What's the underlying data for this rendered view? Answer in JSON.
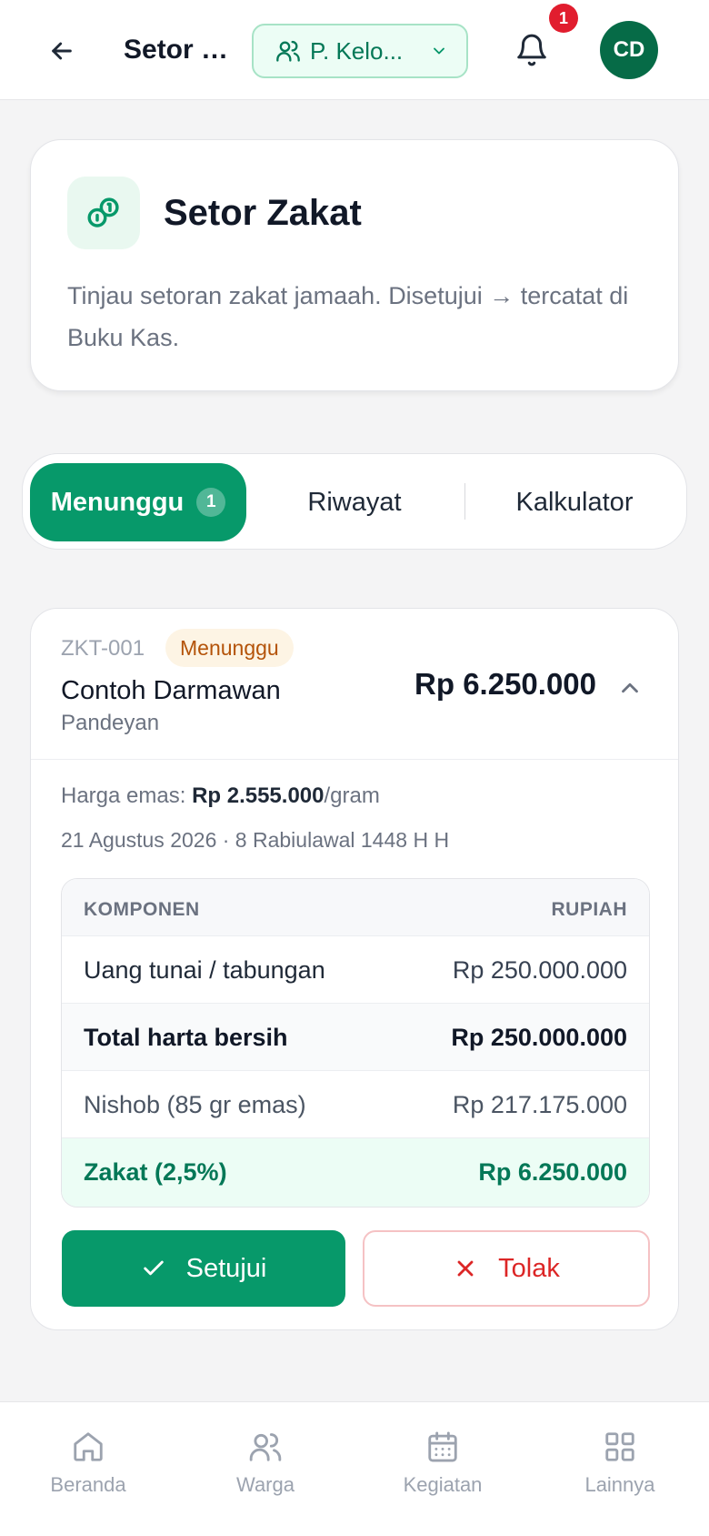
{
  "header": {
    "title": "Setor Z...",
    "org_select": "P. Kelo...",
    "notification_count": "1",
    "avatar_initials": "CD"
  },
  "intro": {
    "title": "Setor Zakat",
    "description": "Tinjau setoran zakat jamaah. Disetujui → tercatat di Buku Kas."
  },
  "tabs": [
    {
      "label": "Menunggu",
      "badge": "1",
      "active": true
    },
    {
      "label": "Riwayat",
      "active": false
    },
    {
      "label": "Kalkulator",
      "active": false
    }
  ],
  "record": {
    "id": "ZKT-001",
    "status": "Menunggu",
    "name": "Contoh Darmawan",
    "location": "Pandeyan",
    "amount": "Rp 6.250.000",
    "gold_label": "Harga emas: ",
    "gold_price": "Rp 2.555.000",
    "gold_unit": "/gram",
    "date": "21 Agustus 2026 · 8 Rabiulawal 1448 H H",
    "table": {
      "header_component": "KOMPONEN",
      "header_amount": "RUPIAH",
      "rows": [
        {
          "label": "Uang tunai / tabungan",
          "value": "Rp 250.000.000"
        },
        {
          "label": "Total harta bersih",
          "value": "Rp 250.000.000"
        },
        {
          "label": "Nishob (85 gr emas)",
          "value": "Rp 217.175.000"
        },
        {
          "label": "Zakat (2,5%)",
          "value": "Rp 6.250.000"
        }
      ]
    },
    "approve_label": "Setujui",
    "reject_label": "Tolak"
  },
  "bottom_nav": [
    {
      "label": "Beranda",
      "icon": "home-icon"
    },
    {
      "label": "Warga",
      "icon": "users-icon"
    },
    {
      "label": "Kegiatan",
      "icon": "calendar-icon"
    },
    {
      "label": "Lainnya",
      "icon": "grid-icon"
    }
  ],
  "colors": {
    "primary": "#07996a",
    "primary_dark": "#066b47",
    "danger": "#dc2626",
    "warning_text": "#b45309"
  }
}
